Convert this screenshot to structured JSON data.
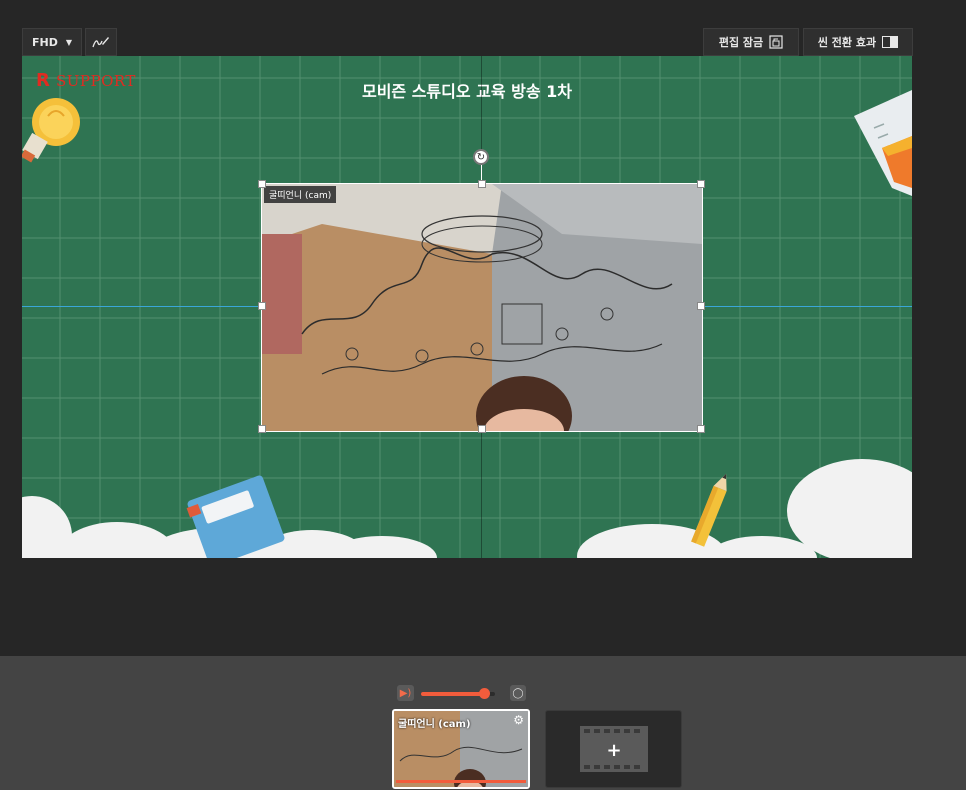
{
  "toolbar": {
    "resolution_label": "FHD",
    "resolution_arrow": "▼",
    "pen_icon": "pen-icon",
    "edit_lock_label": "편집 잠금",
    "scene_transition_label": "씬 전환 효과"
  },
  "stage": {
    "logo_text": "SUPPORT",
    "logo_mark": "R",
    "title": "모비즌 스튜디오 교육 방송 1차",
    "camera_label": "굴띠언니 (cam)",
    "colors": {
      "chalkboard": "#2f7452",
      "grid_line": "#5f9a7a",
      "guide_line": "#3aa6d8",
      "brand_red": "#e02b21"
    }
  },
  "bottom": {
    "volume_percent": 85,
    "scene_thumb_label": "굴띠언니 (cam)",
    "add_scene_icon": "film-add-icon",
    "add_scene_symbol": "+",
    "accent": "#f25c3c"
  }
}
